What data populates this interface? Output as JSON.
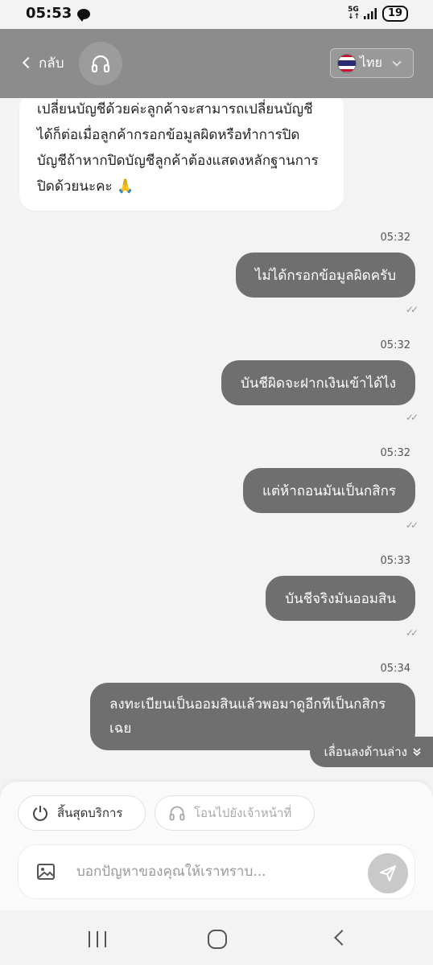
{
  "status_bar": {
    "time": "05:53",
    "network_top": "5G",
    "network_bottom": "↓↑",
    "battery": "19"
  },
  "header": {
    "back_label": "กลับ",
    "language": "ไทย",
    "agent_icon": "headset-icon",
    "flag_icon": "thai-flag-icon"
  },
  "messages": {
    "incoming_text": "เปลี่ยนบัญชีด้วยค่ะลูกค้าจะสามารถเปลี่ยนบัญชีได้ก็ต่อเมื่อลูกค้ากรอกข้อมูลผิดหรือทำการปิดบัญชีถ้าหากปิดบัญชีลูกค้าต้องแสดงหลักฐานการปิดด้วยนะคะ 🙏",
    "outgoing": [
      {
        "time": "05:32",
        "text": "ไม่ได้กรอกข้อมูลผิดครับ",
        "ticks": "✓✓"
      },
      {
        "time": "05:32",
        "text": "บันชีผิดจะฝากเงินเข้าได้ไง",
        "ticks": "✓✓"
      },
      {
        "time": "05:32",
        "text": "แต่ห้าถอนมันเป็นกสิกร",
        "ticks": "✓✓"
      },
      {
        "time": "05:33",
        "text": "บันชีจริงมันออมสิน",
        "ticks": "✓✓"
      },
      {
        "time": "05:34",
        "text": "ลงทะเบียนเป็นออมสินแล้วพอมาดูอีกทีเป็นกสิกรเฉย",
        "ticks": "✓✓"
      }
    ]
  },
  "scroll_down_label": "เลื่อนลงด้านล่าง",
  "actions": {
    "end_service": "สิ้นสุดบริการ",
    "transfer_agent": "โอนไปยังเจ้าหน้าที่"
  },
  "composer": {
    "placeholder": "บอกปัญหาของคุณให้เราทราบ...",
    "value": ""
  },
  "colors": {
    "header_bg": "#8c8c8c",
    "outgoing_bubble": "#6f6f6f",
    "incoming_bubble": "#ffffff",
    "background": "#f3f3f3"
  }
}
